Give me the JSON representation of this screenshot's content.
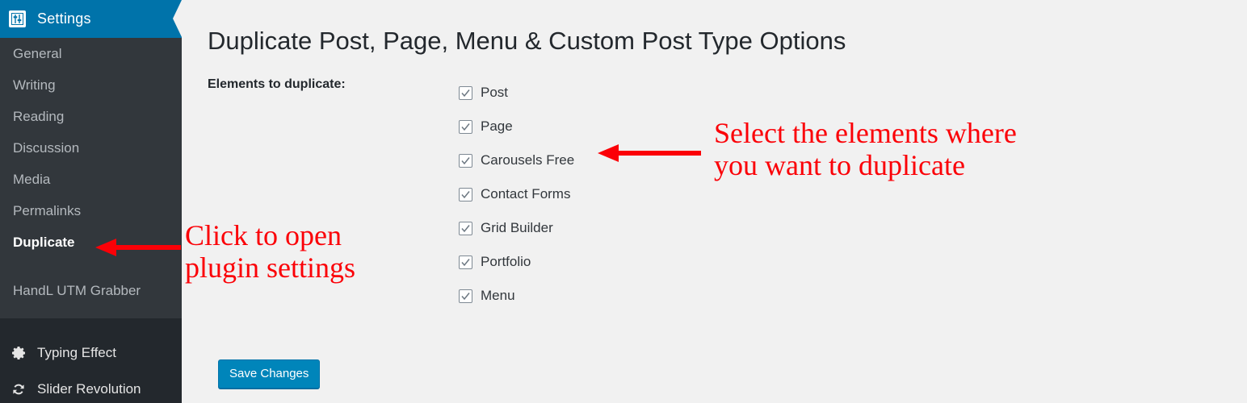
{
  "sidebar": {
    "header": {
      "label": "Settings",
      "icon": "sliders-icon"
    },
    "submenu_items": [
      {
        "label": "General",
        "active": false
      },
      {
        "label": "Writing",
        "active": false
      },
      {
        "label": "Reading",
        "active": false
      },
      {
        "label": "Discussion",
        "active": false
      },
      {
        "label": "Media",
        "active": false
      },
      {
        "label": "Permalinks",
        "active": false
      },
      {
        "label": "Duplicate",
        "active": true
      },
      {
        "label": "HandL UTM Grabber",
        "active": false
      }
    ],
    "main_items": [
      {
        "label": "Typing Effect",
        "icon": "gear-icon"
      },
      {
        "label": "Slider Revolution",
        "icon": "refresh-icon"
      }
    ]
  },
  "content": {
    "page_title": "Duplicate Post, Page, Menu & Custom Post Type Options",
    "field_label": "Elements to duplicate:",
    "checkboxes": [
      {
        "label": "Post",
        "checked": true
      },
      {
        "label": "Page",
        "checked": true
      },
      {
        "label": "Carousels Free",
        "checked": true
      },
      {
        "label": "Contact Forms",
        "checked": true
      },
      {
        "label": "Grid Builder",
        "checked": true
      },
      {
        "label": "Portfolio",
        "checked": true
      },
      {
        "label": "Menu",
        "checked": true
      }
    ],
    "save_button_label": "Save Changes"
  },
  "annotations": [
    {
      "id": "left",
      "text": "Click to open\nplugin settings"
    },
    {
      "id": "right",
      "text": "Select the elements where\nyou want to duplicate"
    }
  ],
  "colors": {
    "sidebar_submenu_bg": "#32373c",
    "sidebar_main_bg": "#23282d",
    "settings_header_bg": "#0073aa",
    "content_bg": "#f1f1f1",
    "button_bg": "#0085ba",
    "annotation_red": "#fb0007"
  }
}
